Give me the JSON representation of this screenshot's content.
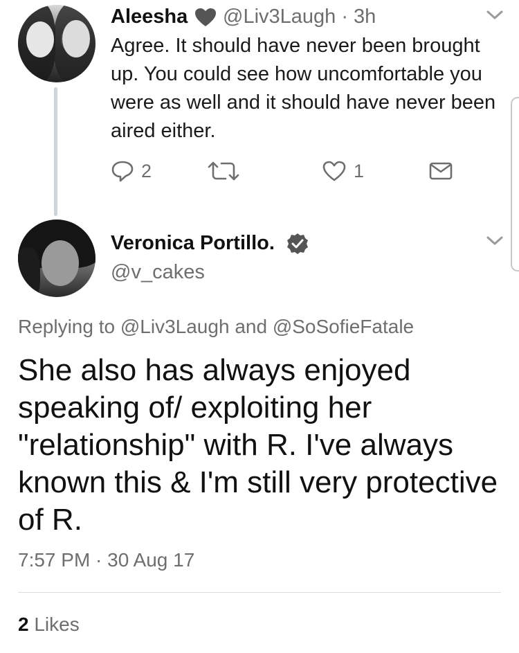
{
  "reply_tweet": {
    "name": "Aleesha",
    "handle_time": "@Liv3Laugh · 3h",
    "text": "Agree. It should have never been brought up. You could see how uncomfortable you were as well and it should have never been aired either.",
    "replies": "2",
    "likes": "1"
  },
  "main_tweet": {
    "name": "Veronica Portillo.",
    "handle": "@v_cakes",
    "replying_prefix": "Replying to",
    "replying_user1": "@Liv3Laugh",
    "replying_and": "and",
    "replying_user2": "@SoSofieFatale",
    "text": "She also has always enjoyed speaking of/ exploiting her \"relationship\" with R. I've always known this & I'm still very protective of R.",
    "timestamp": "7:57 PM · 30 Aug 17",
    "likes_count": "2",
    "likes_label": "Likes"
  },
  "icons": {
    "badge": "heart-icon",
    "verified": "verified-badge-icon",
    "reply": "reply-icon",
    "retweet": "retweet-icon",
    "like": "like-icon",
    "dm": "envelope-icon",
    "menu": "chevron-down-icon"
  },
  "colors": {
    "text": "#1a1a1a",
    "muted": "#6e6e6e",
    "thread_line": "#cfd4d8"
  }
}
